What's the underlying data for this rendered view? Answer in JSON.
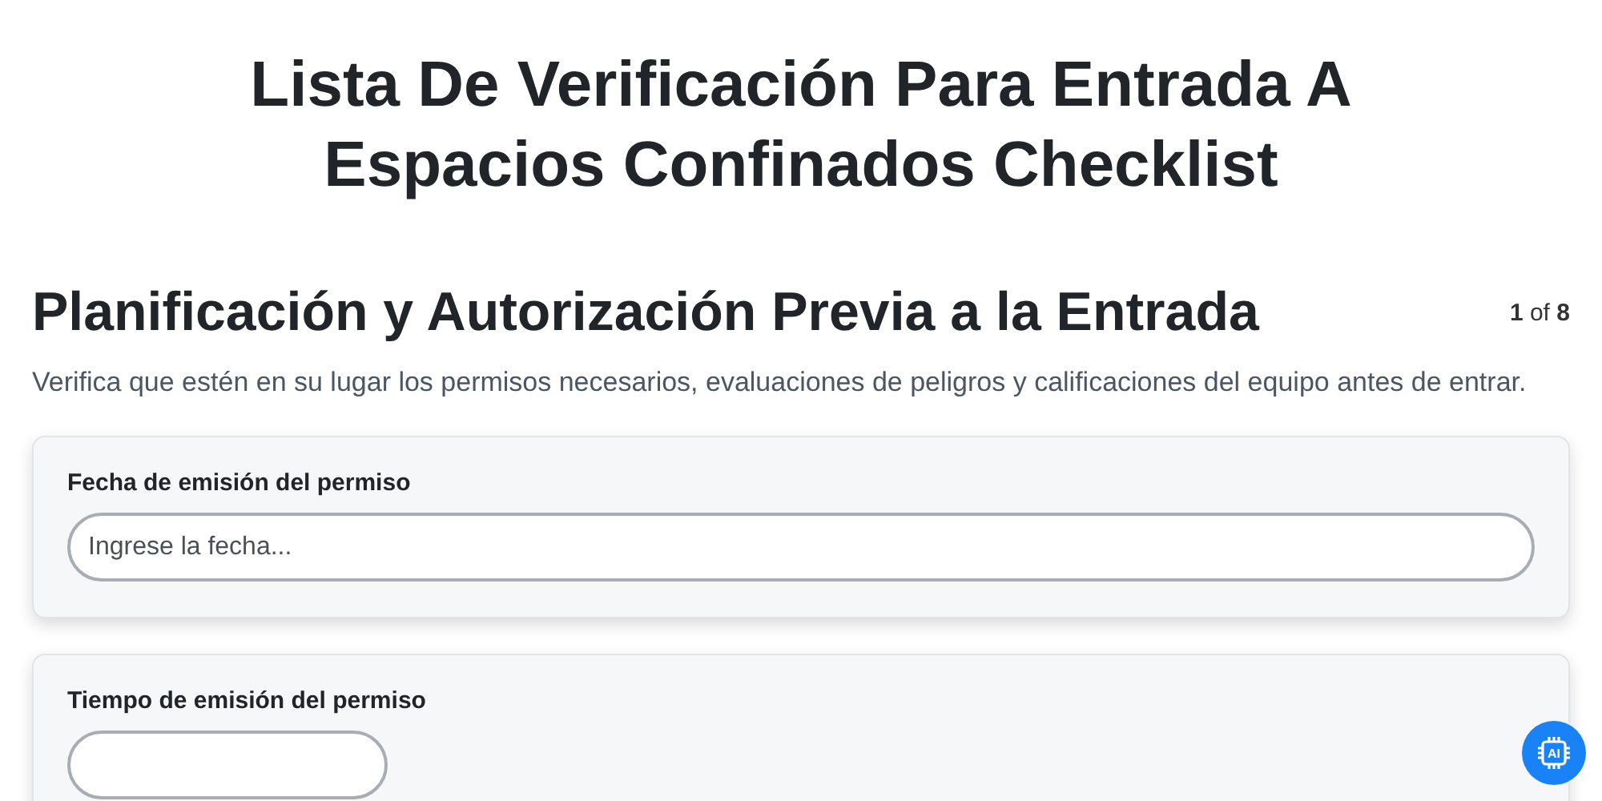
{
  "title": "Lista De Verificación Para Entrada A Espacios Confinados Checklist",
  "section": {
    "heading": "Planificación y Autorización Previa a la Entrada",
    "page_counter": "**1** of **8**",
    "description": "Verifica que estén en su lugar los permisos necesarios, evaluaciones de peligros y calificaciones del equipo antes de entrar."
  },
  "questions": [
    {
      "label": "Fecha de emisión del permiso",
      "kind": "date",
      "placeholder": "Ingrese la fecha..."
    },
    {
      "label": "Tiempo de emisión del permiso",
      "kind": "time"
    }
  ],
  "assistant_button": {
    "label": "AI"
  }
}
